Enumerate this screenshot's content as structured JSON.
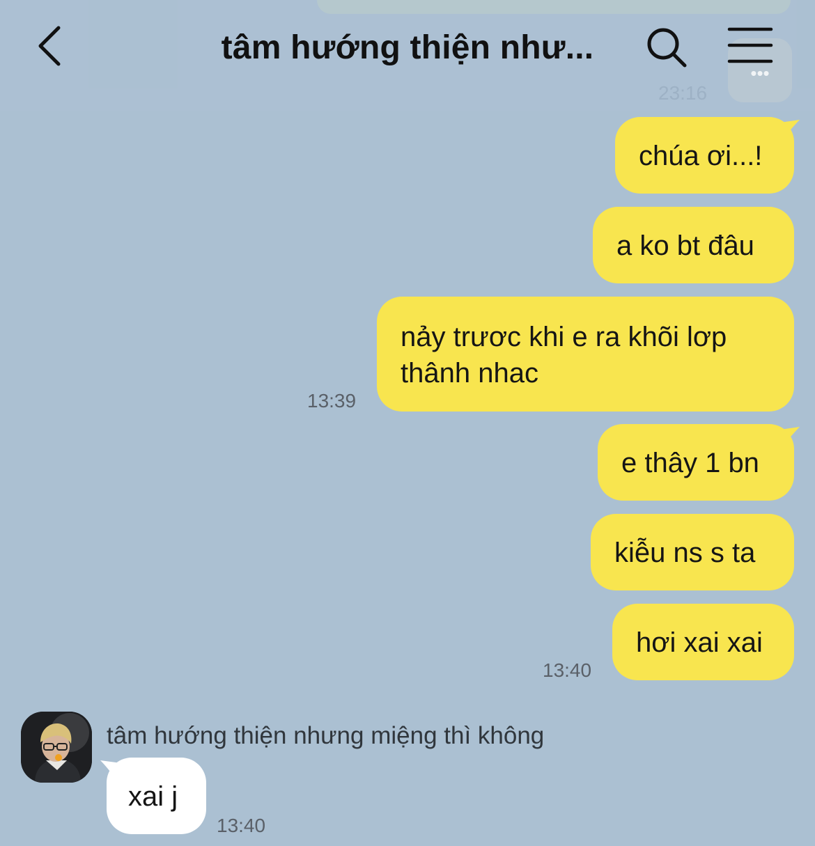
{
  "header": {
    "title": "tâm hướng thiện như...",
    "faded_time": "23:16",
    "faded_dots": "•••"
  },
  "messages_sent": [
    {
      "text": "chúa ơi...!"
    },
    {
      "text": "a ko bt đâu"
    },
    {
      "line1": "nảy trươc khi e ra khõi lơp",
      "line2": "thânh nhac",
      "time": "13:39"
    },
    {
      "text": "e thây 1 bn"
    },
    {
      "text": "kiễu ns s ta"
    },
    {
      "text": "hơi xai xai",
      "time": "13:40"
    }
  ],
  "message_received": {
    "sender": "tâm hướng thiện nhưng miệng thì không",
    "text": "xai j",
    "time": "13:40"
  },
  "colors": {
    "background": "#abc0d2",
    "sent_bubble": "#f8e54f",
    "received_bubble": "#ffffff"
  }
}
